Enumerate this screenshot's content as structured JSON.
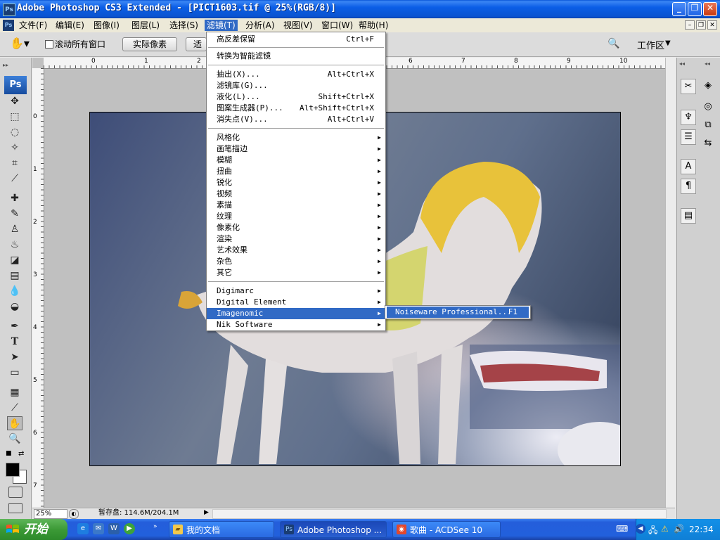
{
  "window": {
    "app_icon": "Ps",
    "title": "Adobe Photoshop CS3 Extended - [PICT1603.tif @ 25%(RGB/8)]",
    "buttons": {
      "minimize": "_",
      "maximize": "❐",
      "close": "✕"
    }
  },
  "menubar": {
    "icon": "Ps",
    "items": [
      "文件(F)",
      "编辑(E)",
      "图像(I)",
      "图层(L)",
      "选择(S)",
      "滤镜(T)",
      "分析(A)",
      "视图(V)",
      "窗口(W)",
      "帮助(H)"
    ],
    "active_index": 5
  },
  "options_bar": {
    "scroll_all_windows": "滚动所有窗口",
    "actual_pixels": "实际像素",
    "fit_screen": "适",
    "workspace": "工作区"
  },
  "rulers": {
    "top": [
      "0",
      "1",
      "2",
      "6",
      "7",
      "8",
      "9",
      "10"
    ],
    "left": [
      "0",
      "1",
      "2",
      "3",
      "4",
      "5",
      "6",
      "7"
    ]
  },
  "filter_menu": {
    "groups": [
      [
        {
          "label": "高反差保留",
          "shortcut": "Ctrl+F"
        }
      ],
      [
        {
          "label": "转换为智能滤镜",
          "shortcut": ""
        }
      ],
      [
        {
          "label": "抽出(X)...",
          "shortcut": "Alt+Ctrl+X"
        },
        {
          "label": "滤镜库(G)...",
          "shortcut": ""
        },
        {
          "label": "液化(L)...",
          "shortcut": "Shift+Ctrl+X"
        },
        {
          "label": "图案生成器(P)...",
          "shortcut": "Alt+Shift+Ctrl+X"
        },
        {
          "label": "消失点(V)...",
          "shortcut": "Alt+Ctrl+V"
        }
      ],
      [
        {
          "label": "风格化",
          "submenu": true
        },
        {
          "label": "画笔描边",
          "submenu": true
        },
        {
          "label": "模糊",
          "submenu": true
        },
        {
          "label": "扭曲",
          "submenu": true
        },
        {
          "label": "锐化",
          "submenu": true
        },
        {
          "label": "视频",
          "submenu": true
        },
        {
          "label": "素描",
          "submenu": true
        },
        {
          "label": "纹理",
          "submenu": true
        },
        {
          "label": "像素化",
          "submenu": true
        },
        {
          "label": "渲染",
          "submenu": true
        },
        {
          "label": "艺术效果",
          "submenu": true
        },
        {
          "label": "杂色",
          "submenu": true
        },
        {
          "label": "其它",
          "submenu": true
        }
      ],
      [
        {
          "label": "Digimarc",
          "submenu": true
        },
        {
          "label": "Digital Element",
          "submenu": true
        },
        {
          "label": "Imagenomic",
          "submenu": true,
          "highlighted": true
        },
        {
          "label": "Nik Software",
          "submenu": true
        }
      ]
    ],
    "submenu": {
      "label": "Noiseware Professional...",
      "shortcut": "F1"
    }
  },
  "status": {
    "zoom": "25%",
    "scratch": "暂存盘: 114.6M/204.1M"
  },
  "taskbar": {
    "start": "开始",
    "tasks": [
      {
        "label": "我的文档",
        "icon": "folder-icon"
      },
      {
        "label": "Adobe Photoshop ...",
        "icon": "photoshop-icon",
        "active": true
      },
      {
        "label": "歌曲 - ACDSee 10",
        "icon": "acdsee-icon"
      }
    ],
    "clock": "22:34"
  },
  "colors": {
    "titlebar": "#0a54d0",
    "menu_highlight": "#316ac5",
    "taskbar": "#245edb",
    "start_green": "#3c9a36"
  }
}
